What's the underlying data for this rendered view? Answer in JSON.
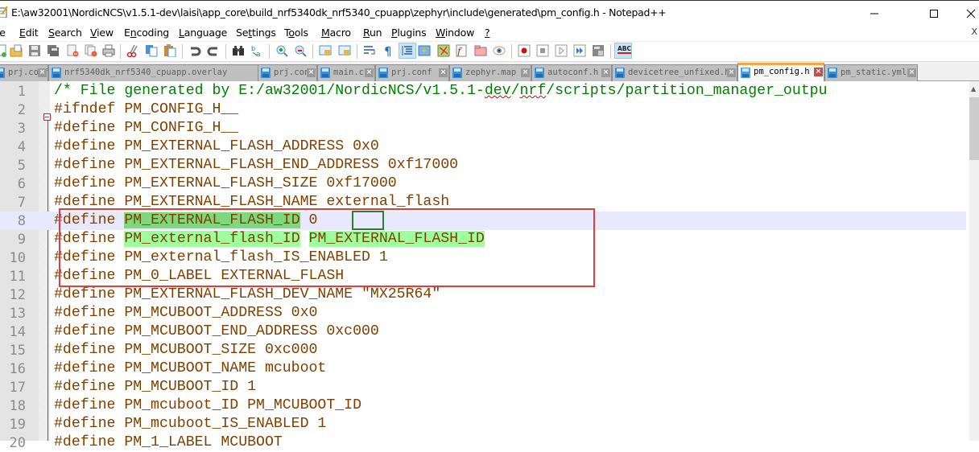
{
  "window": {
    "title": "E:\\aw32001\\NordicNCS\\v1.5.1-dev\\laisi\\app_core\\build_nrf5340dk_nrf5340_cpuapp\\zephyr\\include\\generated\\pm_config.h - Notepad++",
    "minimize_icon": "minimize-icon",
    "maximize_icon": "maximize-icon",
    "close_icon": "close-icon"
  },
  "menu": {
    "items": [
      {
        "label": "le",
        "accel": ""
      },
      {
        "label": "Edit",
        "accel": "E"
      },
      {
        "label": "Search",
        "accel": "S"
      },
      {
        "label": "View",
        "accel": "V"
      },
      {
        "label": "Encoding",
        "accel": "n"
      },
      {
        "label": "Language",
        "accel": "L"
      },
      {
        "label": "Settings",
        "accel": "t"
      },
      {
        "label": "Tools",
        "accel": "o"
      },
      {
        "label": "Macro",
        "accel": "M"
      },
      {
        "label": "Run",
        "accel": "R"
      },
      {
        "label": "Plugins",
        "accel": "P"
      },
      {
        "label": "Window",
        "accel": "W"
      },
      {
        "label": "?",
        "accel": "?"
      }
    ],
    "close": "X"
  },
  "toolbar": {
    "buttons": [
      "new-file",
      "open-file",
      "save",
      "save-all",
      "close",
      "close-all",
      "print",
      "cut",
      "copy",
      "paste",
      "undo",
      "redo",
      "find",
      "replace",
      "zoom-in",
      "zoom-out",
      "sync-vertical",
      "sync-horizontal",
      "word-wrap",
      "show-all-chars",
      "indent-guide",
      "udl",
      "doc-map",
      "function-list",
      "folder-as-workspace",
      "monitoring",
      "record-macro",
      "stop-macro",
      "play-macro",
      "run-macro-multiple",
      "save-macro",
      "spell-check"
    ],
    "spell_label": "ABC"
  },
  "tabs": [
    {
      "label": "prj.conf",
      "active": false
    },
    {
      "label": "nrf5340dk_nrf5340_cpuapp.overlay",
      "active": false
    },
    {
      "label": "prj.conf",
      "active": false
    },
    {
      "label": "main.c",
      "active": false
    },
    {
      "label": "prj.conf",
      "active": false
    },
    {
      "label": "zephyr.map",
      "active": false
    },
    {
      "label": "autoconf.h",
      "active": false
    },
    {
      "label": "devicetree_unfixed.h",
      "active": false
    },
    {
      "label": "pm_config.h",
      "active": true
    },
    {
      "label": "pm_static.yml",
      "active": false
    }
  ],
  "editor": {
    "current_line": 8,
    "lines": [
      {
        "n": "1",
        "text": "/* File generated by E:/aw32001/NordicNCS/v1.5.1-dev/nrf/scripts/partition_manager_outpu",
        "type": "comment"
      },
      {
        "n": "2",
        "text": "#ifndef PM_CONFIG_H__",
        "type": "code"
      },
      {
        "n": "3",
        "text": "#define PM_CONFIG_H__",
        "type": "code"
      },
      {
        "n": "4",
        "text": "#define PM_EXTERNAL_FLASH_ADDRESS 0x0",
        "type": "code"
      },
      {
        "n": "5",
        "text": "#define PM_EXTERNAL_FLASH_END_ADDRESS 0xf17000",
        "type": "code"
      },
      {
        "n": "6",
        "text": "#define PM_EXTERNAL_FLASH_SIZE 0xf17000",
        "type": "code"
      },
      {
        "n": "7",
        "text": "#define PM_EXTERNAL_FLASH_NAME external_flash",
        "type": "code"
      },
      {
        "n": "8",
        "text": "#define PM_EXTERNAL_FLASH_ID 0",
        "type": "code"
      },
      {
        "n": "9",
        "text": "#define PM_external_flash_ID PM_EXTERNAL_FLASH_ID",
        "type": "code"
      },
      {
        "n": "10",
        "text": "#define PM_external_flash_IS_ENABLED 1",
        "type": "code"
      },
      {
        "n": "11",
        "text": "#define PM_0_LABEL EXTERNAL_FLASH",
        "type": "code"
      },
      {
        "n": "12",
        "text": "#define PM_EXTERNAL_FLASH_DEV_NAME \"MX25R64\"",
        "type": "code"
      },
      {
        "n": "13",
        "text": "#define PM_MCUBOOT_ADDRESS 0x0",
        "type": "code"
      },
      {
        "n": "14",
        "text": "#define PM_MCUBOOT_END_ADDRESS 0xc000",
        "type": "code"
      },
      {
        "n": "15",
        "text": "#define PM_MCUBOOT_SIZE 0xc000",
        "type": "code"
      },
      {
        "n": "16",
        "text": "#define PM_MCUBOOT_NAME mcuboot",
        "type": "code"
      },
      {
        "n": "17",
        "text": "#define PM_MCUBOOT_ID 1",
        "type": "code"
      },
      {
        "n": "18",
        "text": "#define PM_mcuboot_ID PM_MCUBOOT_ID",
        "type": "code"
      },
      {
        "n": "19",
        "text": "#define PM_mcuboot_IS_ENABLED 1",
        "type": "code"
      },
      {
        "n": "20",
        "text": "#define PM_1_LABEL MCUBOOT",
        "type": "code"
      }
    ],
    "line1_parts": {
      "a": "/* File generated by E:/aw32001/NordicNCS/v1.5.1-",
      "dev": "dev",
      "slash": "/",
      "nrf": "nrf",
      "rest": "/scripts/partition_manager_outpu"
    },
    "line8_parts": {
      "pre": "#define ",
      "hl": "PM_EXTERNAL_FLASH_ID",
      "sp": " ",
      "val": "0"
    },
    "line9_parts": {
      "pre": "#define ",
      "hl1": "PM_external_flash_ID",
      "sp": " ",
      "hl2": "PM_EXTERNAL_FLASH_ID"
    }
  },
  "annotations": {
    "red_box_color": "#ea3b3b",
    "green_box_color": "#2e7d32",
    "highlight_color": "#7ed87e"
  }
}
